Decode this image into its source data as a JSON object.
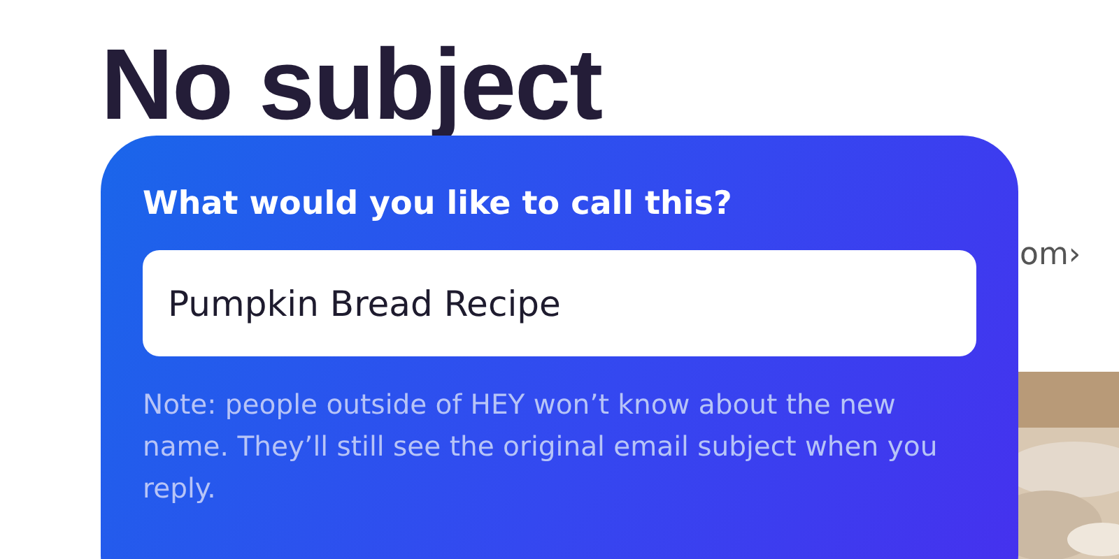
{
  "page": {
    "title": "No subject",
    "partial_link": "om›"
  },
  "rename_dialog": {
    "heading": "What would you like to call this?",
    "value": "Pumpkin Bread Recipe",
    "note": "Note: people outside of HEY won’t know about the new name. They’ll still see the original email subject when you reply."
  }
}
